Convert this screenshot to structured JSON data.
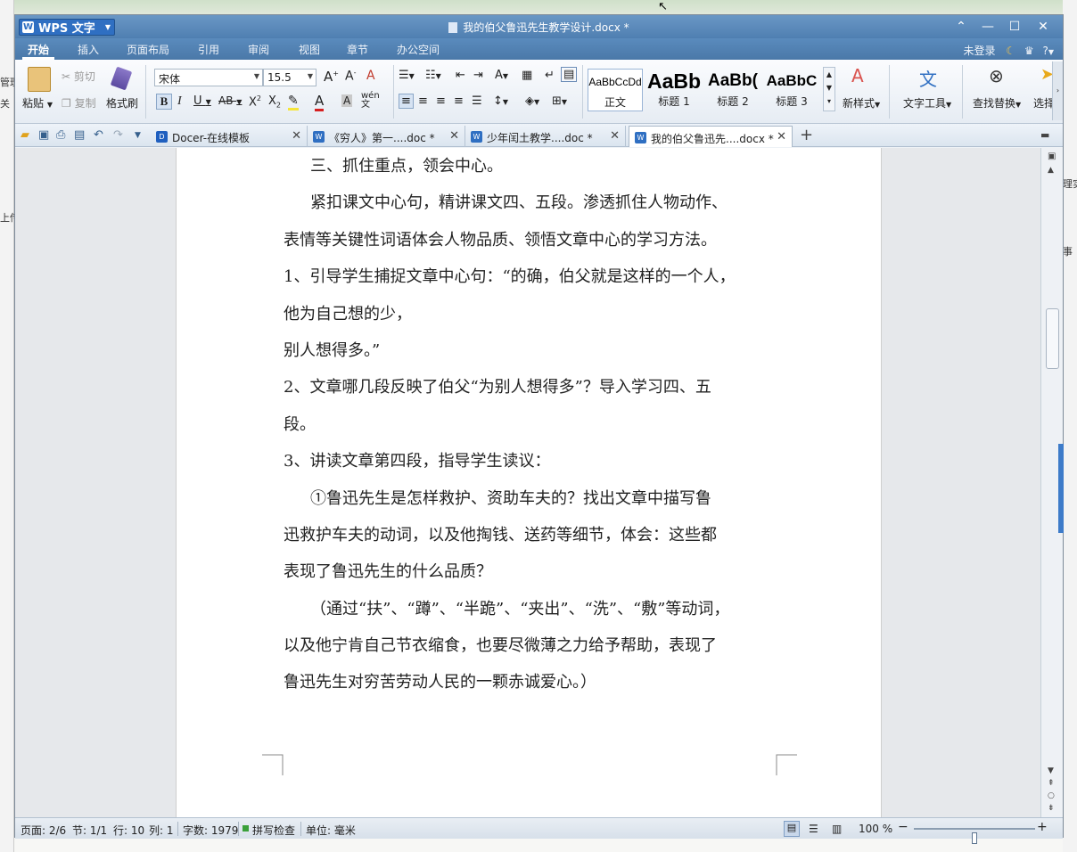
{
  "app": {
    "name": "WPS 文字",
    "doc_title": "我的伯父鲁迅先生教学设计.docx *"
  },
  "background": {
    "left_texts": [
      "管理",
      "关",
      "上传"
    ],
    "right_texts": [
      "理实",
      "事"
    ]
  },
  "menu": {
    "items": [
      "开始",
      "插入",
      "页面布局",
      "引用",
      "审阅",
      "视图",
      "章节",
      "办公空间"
    ],
    "active": "开始",
    "login": "未登录",
    "help": "?"
  },
  "ribbon": {
    "paste": "粘贴",
    "cut": "剪切",
    "copy": "复制",
    "format_painter": "格式刷",
    "font_name": "宋体",
    "font_size": "15.5",
    "styles": [
      {
        "preview": "AaBbCcDd",
        "label": "正文"
      },
      {
        "preview": "AaBb",
        "label": "标题 1"
      },
      {
        "preview": "AaBb(",
        "label": "标题 2"
      },
      {
        "preview": "AaBbC",
        "label": "标题 3"
      }
    ],
    "new_style": "新样式",
    "text_tools": "文字工具",
    "find_replace": "查找替换",
    "select": "选择"
  },
  "tabs": [
    {
      "label": "Docer-在线模板",
      "active": false
    },
    {
      "label": "《穷人》第一....doc *",
      "active": false
    },
    {
      "label": "少年闰土教学....doc *",
      "active": false
    },
    {
      "label": "我的伯父鲁迅先....docx *",
      "active": true
    }
  ],
  "document": {
    "paragraphs": [
      {
        "text": "三、抓住重点，领会中心。",
        "indent": true
      },
      {
        "text": "紧扣课文中心句，精讲课文四、五段。渗透抓住人物动作、",
        "indent": true
      },
      {
        "text": "表情等关键性词语体会人物品质、领悟文章中心的学习方法。",
        "indent": false
      },
      {
        "text": "1、引导学生捕捉文章中心句：“的确，伯父就是这样的一个人，",
        "indent": false
      },
      {
        "text": "他为自己想的少，",
        "indent": false
      },
      {
        "text": "别人想得多。”",
        "indent": false
      },
      {
        "text": "2、文章哪几段反映了伯父“为别人想得多”？导入学习四、五",
        "indent": false
      },
      {
        "text": "段。",
        "indent": false
      },
      {
        "text": "3、讲读文章第四段，指导学生读议：",
        "indent": false
      },
      {
        "text": "①鲁迅先生是怎样救护、资助车夫的？找出文章中描写鲁",
        "indent": true
      },
      {
        "text": "迅救护车夫的动词，以及他掏钱、送药等细节，体会：这些都",
        "indent": false
      },
      {
        "text": "表现了鲁迅先生的什么品质？",
        "indent": false
      },
      {
        "text": "（通过“扶”、“蹲”、“半跪”、“夹出”、“洗”、“敷”等动词，",
        "indent": true
      },
      {
        "text": "以及他宁肯自己节衣缩食，也要尽微薄之力给予帮助，表现了",
        "indent": false
      },
      {
        "text": "鲁迅先生对穷苦劳动人民的一颗赤诚爱心。）",
        "indent": false
      }
    ]
  },
  "status": {
    "page": "页面: 2/6",
    "section": "节: 1/1",
    "row": "行: 10",
    "col": "列: 1",
    "word_count": "字数: 1979",
    "spell_check": "拼写检查",
    "unit": "单位: 毫米",
    "zoom": "100 %",
    "zoom_level": 0.5
  }
}
